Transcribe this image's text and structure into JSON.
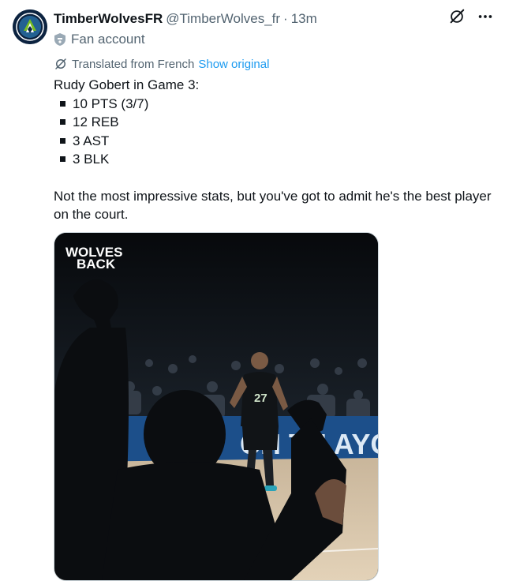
{
  "tweet": {
    "author_name": "TimberWolvesFR",
    "author_handle": "@TimberWolves_fr",
    "separator": "·",
    "time_ago": "13m",
    "account_label": "Fan account",
    "translation_note": "Translated from French",
    "show_original_label": "Show original",
    "intro": "Rudy Gobert in Game 3:",
    "stats": [
      "10 PTS (3/7)",
      "12 REB",
      "3 AST",
      "3 BLK"
    ],
    "closing": "Not the most impressive stats, but you've got to admit he's the best player on the court."
  },
  "media": {
    "logo_line1": "WOLVES",
    "logo_line2": "BACK",
    "jersey_number": "27",
    "banner_text": "CH TH  AYOF"
  },
  "colors": {
    "link": "#1d9bf0",
    "secondary_text": "#536471",
    "team_navy": "#0c2340"
  }
}
